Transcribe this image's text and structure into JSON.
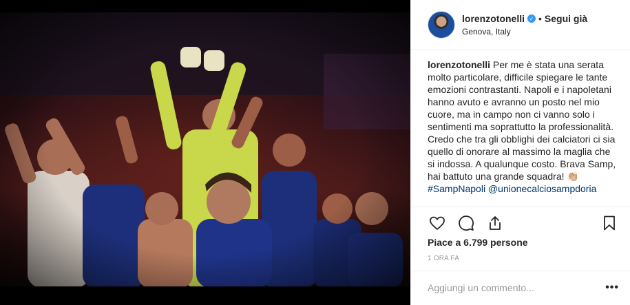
{
  "post": {
    "username": "lorenzotonelli",
    "verified_symbol": "✓",
    "separator": "•",
    "follow_label": "Segui già",
    "location": "Genova, Italy"
  },
  "caption": {
    "username": "lorenzotonelli",
    "text": " Per me è stata una serata molto particolare, difficile spiegare le tante emozioni contrastanti. Napoli e i napoletani hanno avuto e avranno un posto nel mio cuore, ma in campo non ci vanno solo i sentimenti ma soprattutto la professionalità. Credo che tra gli obblighi dei calciatori ci sia quello di onorare al massimo la maglia che si indossa. A qualunque costo. Brava Samp, hai battuto una grande squadra! ",
    "emoji": "👏🏼",
    "hashtag": "#SampNapoli",
    "mention": "@unionecalciosampdoria"
  },
  "actions": {
    "like_icon": "heart-icon",
    "comment_icon": "comment-icon",
    "share_icon": "share-icon",
    "save_icon": "bookmark-icon"
  },
  "likes_label": "Piace a 6.799 persone",
  "timestamp": "1 ORA FA",
  "comment_box": {
    "placeholder": "Aggiungi un commento...",
    "more": "•••"
  },
  "colors": {
    "link": "#003569",
    "verified": "#3897f0",
    "muted": "#999999"
  }
}
